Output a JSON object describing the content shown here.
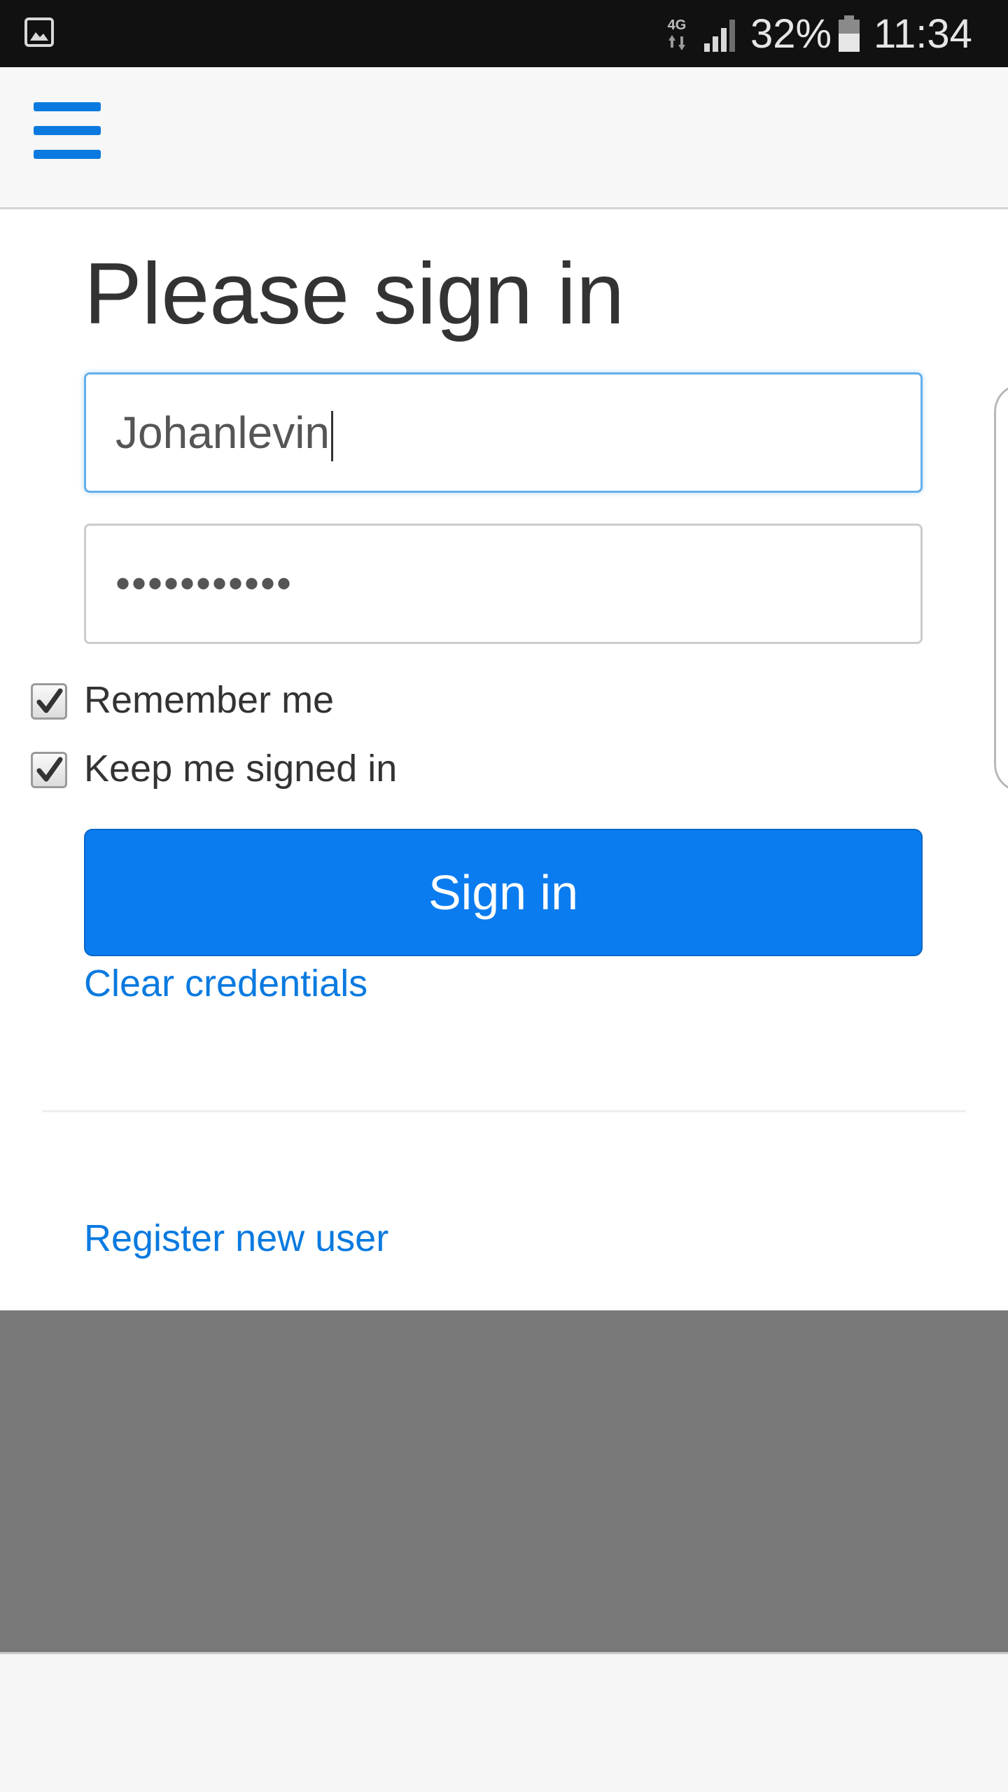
{
  "status_bar": {
    "network_type": "4G",
    "battery_percent": "32%",
    "time": "11:34",
    "icons": [
      "gallery-icon",
      "network-4g-icon",
      "signal-icon",
      "battery-icon"
    ]
  },
  "navbar": {
    "menu_icon": "hamburger-menu-icon"
  },
  "form": {
    "title": "Please sign in",
    "username_value": "Johanlevin",
    "password_mask": "•••••••••••",
    "remember_me_label": "Remember me",
    "remember_me_checked": true,
    "keep_signed_in_label": "Keep me signed in",
    "keep_signed_in_checked": true,
    "submit_label": "Sign in",
    "clear_link": "Clear credentials"
  },
  "footer": {
    "register_link": "Register new user"
  },
  "colors": {
    "accent": "#0a7cf0",
    "link": "#0a7ae0",
    "status_bar_bg": "#111111",
    "overlay": "#787878",
    "focus_border": "#66afe9"
  }
}
